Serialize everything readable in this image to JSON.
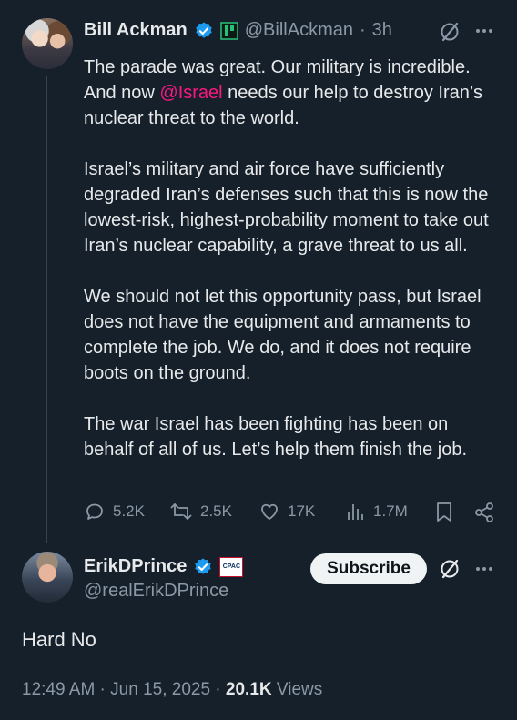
{
  "parent_tweet": {
    "author_name": "Bill Ackman",
    "handle": "@BillAckman",
    "separator": "·",
    "time": "3h",
    "paragraphs": [
      {
        "before": "The parade was great. Our military is incredible. And now ",
        "mention": "@Israel",
        "after": " needs our help to destroy Iran’s nuclear threat to the world."
      },
      {
        "text": "Israel’s military and air force have sufficiently degraded Iran’s defenses such that this is now the lowest-risk, highest-probability moment to take out Iran’s nuclear capability, a grave threat to us all."
      },
      {
        "text": "We should not let this opportunity pass, but Israel does not have the equipment and armaments to complete the job. We do, and it does not require boots on the ground."
      },
      {
        "text": "The war Israel has been fighting has been on behalf of all of us. Let’s help them finish the job."
      }
    ],
    "actions": {
      "replies": "5.2K",
      "reposts": "2.5K",
      "likes": "17K",
      "views": "1.7M"
    }
  },
  "main_tweet": {
    "author_name": "ErikDPrince",
    "handle": "@realErikDPrince",
    "badge_label": "CPAC",
    "subscribe_label": "Subscribe",
    "text": "Hard No",
    "timestamp": "12:49 AM · Jun 15, 2025 ·",
    "views_count": "20.1K",
    "views_label": "Views"
  },
  "colors": {
    "background": "#15202b",
    "verified": "#1d9bf0",
    "mention": "#f91880",
    "muted": "#8b98a5"
  }
}
